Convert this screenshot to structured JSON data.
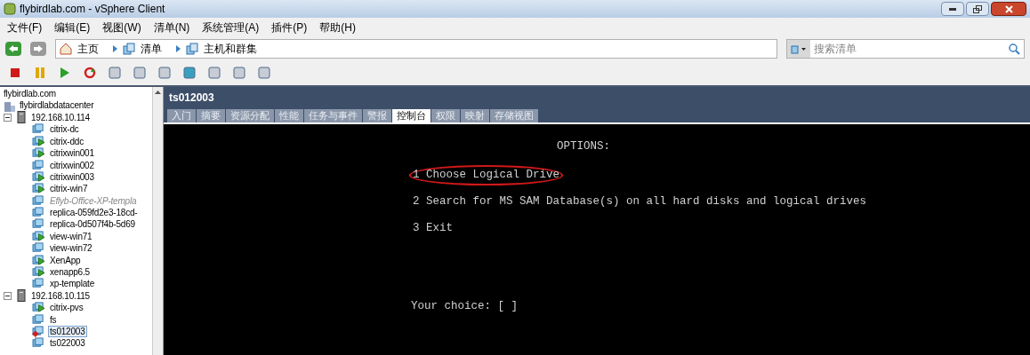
{
  "window": {
    "title": "flybirdlab.com - vSphere Client"
  },
  "menu": [
    "文件(F)",
    "编辑(E)",
    "视图(W)",
    "清单(N)",
    "系统管理(A)",
    "插件(P)",
    "帮助(H)"
  ],
  "breadcrumb": [
    {
      "label": "主页",
      "kind": "home"
    },
    {
      "label": "清单",
      "kind": "inventory"
    },
    {
      "label": "主机和群集",
      "kind": "hosts"
    }
  ],
  "search": {
    "placeholder": "搜索清单"
  },
  "tree": {
    "root": "flybirdlab.com",
    "datacenter": "flybirdlabdatacenter",
    "hosts": [
      {
        "label": "192.168.10.114",
        "expanded": true,
        "children": [
          {
            "label": "citrix-dc",
            "kind": "vm",
            "powered_on": false,
            "alert": false,
            "selected": false
          },
          {
            "label": "citrix-ddc",
            "kind": "vm",
            "powered_on": true,
            "alert": false,
            "selected": false
          },
          {
            "label": "citrixwin001",
            "kind": "vm",
            "powered_on": true,
            "alert": false,
            "selected": false
          },
          {
            "label": "citrixwin002",
            "kind": "vm",
            "powered_on": false,
            "alert": false,
            "selected": false
          },
          {
            "label": "citrixwin003",
            "kind": "vm",
            "powered_on": true,
            "alert": false,
            "selected": false
          },
          {
            "label": "citrix-win7",
            "kind": "vm",
            "powered_on": true,
            "alert": false,
            "selected": false
          },
          {
            "label": "Eflyb-Office-XP-templa",
            "kind": "template",
            "powered_on": false,
            "alert": false,
            "selected": false
          },
          {
            "label": "replica-059fd2e3-18cd-",
            "kind": "vm",
            "powered_on": false,
            "alert": false,
            "selected": false
          },
          {
            "label": "replica-0d507f4b-5d69",
            "kind": "vm",
            "powered_on": false,
            "alert": false,
            "selected": false
          },
          {
            "label": "view-win71",
            "kind": "vm",
            "powered_on": true,
            "alert": false,
            "selected": false
          },
          {
            "label": "view-win72",
            "kind": "vm",
            "powered_on": false,
            "alert": false,
            "selected": false
          },
          {
            "label": "XenApp",
            "kind": "vm",
            "powered_on": true,
            "alert": false,
            "selected": false
          },
          {
            "label": "xenapp6.5",
            "kind": "vm",
            "powered_on": true,
            "alert": false,
            "selected": false
          },
          {
            "label": "xp-template",
            "kind": "vm",
            "powered_on": false,
            "alert": false,
            "selected": false
          }
        ]
      },
      {
        "label": "192.168.10.115",
        "expanded": true,
        "children": [
          {
            "label": "citrix-pvs",
            "kind": "vm",
            "powered_on": true,
            "alert": false,
            "selected": false
          },
          {
            "label": "fs",
            "kind": "vm",
            "powered_on": false,
            "alert": false,
            "selected": false
          },
          {
            "label": "ts012003",
            "kind": "vm",
            "powered_on": false,
            "alert": true,
            "selected": true
          },
          {
            "label": "ts022003",
            "kind": "vm",
            "powered_on": false,
            "alert": false,
            "selected": false
          }
        ]
      }
    ]
  },
  "panel": {
    "title": "ts012003",
    "tabs": [
      {
        "label": "入门",
        "selected": false
      },
      {
        "label": "摘要",
        "selected": false
      },
      {
        "label": "资源分配",
        "selected": false
      },
      {
        "label": "性能",
        "selected": false
      },
      {
        "label": "任务与事件",
        "selected": false
      },
      {
        "label": "警报",
        "selected": false
      },
      {
        "label": "控制台",
        "selected": true
      },
      {
        "label": "权限",
        "selected": false
      },
      {
        "label": "映射",
        "selected": false
      },
      {
        "label": "存储视图",
        "selected": false
      }
    ]
  },
  "console": {
    "heading": "OPTIONS:",
    "options": [
      {
        "text": "1 Choose Logical Drive",
        "circled": true
      },
      {
        "text": "2 Search for MS SAM Database(s) on all hard disks and logical drives",
        "circled": false
      },
      {
        "text": "3 Exit",
        "circled": false
      }
    ],
    "prompt": "Your choice: [ ]"
  }
}
